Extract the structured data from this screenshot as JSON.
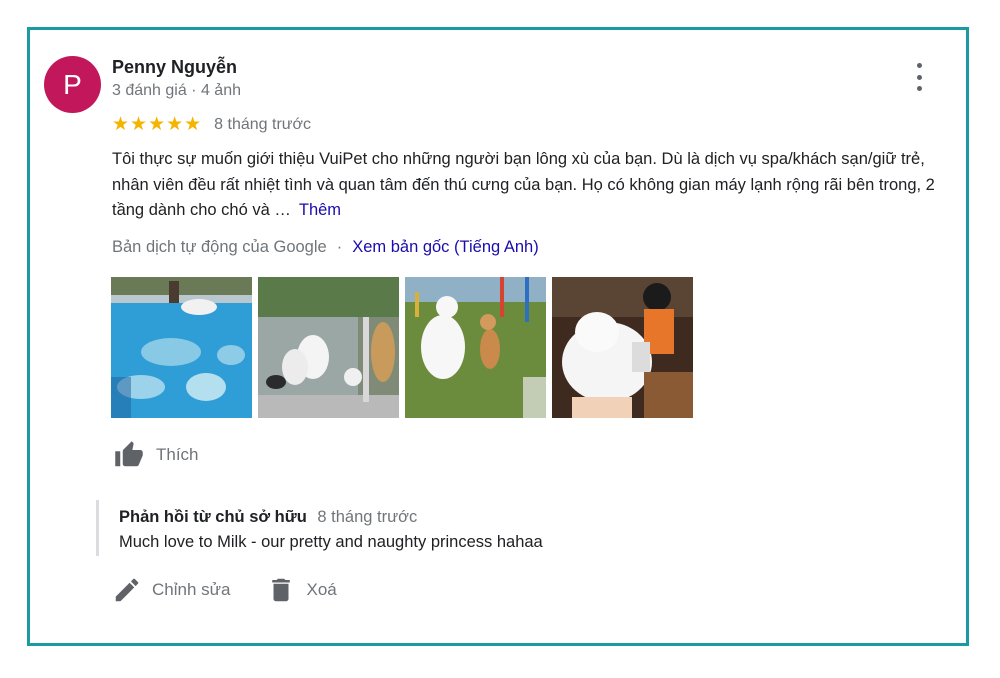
{
  "review": {
    "avatar_letter": "P",
    "avatar_color": "#c2185b",
    "reviewer_name": "Penny Nguyễn",
    "reviewer_meta": "3 đánh giá · 4 ảnh",
    "stars": "★★★★★",
    "rating": 5,
    "time": "8 tháng trước",
    "text": "Tôi thực sự muốn giới thiệu VuiPet cho những người bạn lông xù của bạn. Dù là dịch vụ spa/khách sạn/giữ trẻ, nhân viên đều rất nhiệt tình và quan tâm đến thú cưng của bạn. Họ có không gian máy lạnh rộng rãi bên trong, 2 tầng dành cho chó và …",
    "more_label": "Thêm",
    "translation_note": "Bản dịch tự động của Google",
    "separator": "·",
    "view_original_label": "Xem bản gốc (Tiếng Anh)",
    "photos": [
      {
        "subject": "dogs-in-pool"
      },
      {
        "subject": "white-dogs-by-glass"
      },
      {
        "subject": "samoyed-and-corgi-on-grass"
      },
      {
        "subject": "groomer-drying-samoyed"
      }
    ],
    "like_label": "Thích"
  },
  "owner_reply": {
    "heading": "Phản hồi từ chủ sở hữu",
    "time": "8 tháng trước",
    "text": "Much love to Milk - our pretty and naughty princess hahaa"
  },
  "actions": {
    "edit_label": "Chỉnh sửa",
    "delete_label": "Xoá"
  },
  "colors": {
    "frame_border": "#1a9aa1",
    "star": "#f4b400",
    "link": "#1a0dab",
    "secondary_text": "#70757a"
  }
}
